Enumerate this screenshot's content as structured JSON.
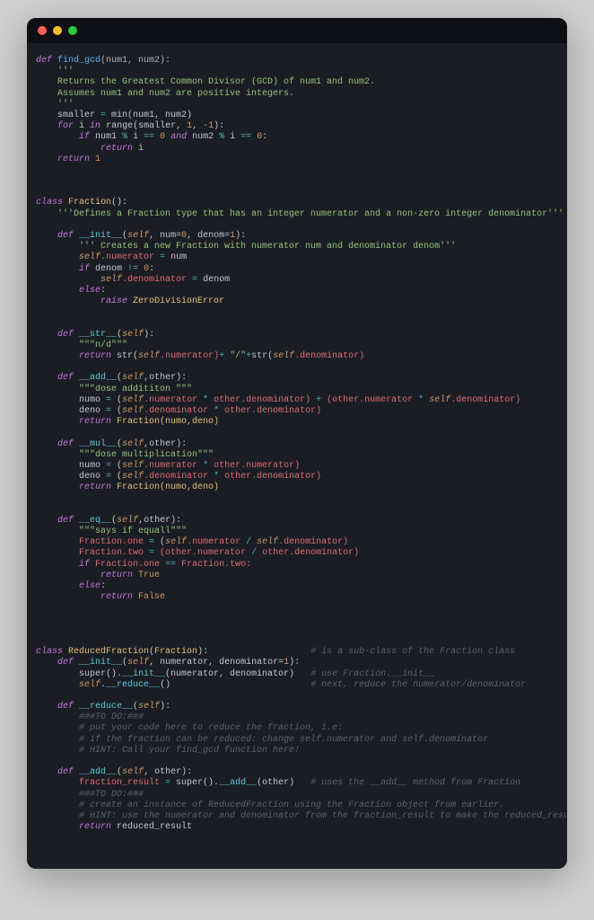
{
  "titlebar": {
    "dots": [
      "red",
      "yellow",
      "green"
    ]
  },
  "code": {
    "l1": "def ",
    "l1b": "find_gcd",
    "l1c": "(num1, num2):",
    "l2": "    '''",
    "l3": "    Returns the Greatest Common Divisor (GCD) of num1 and num2.",
    "l4": "    Assumes num1 and num2 are positive integers.",
    "l5": "    '''",
    "l6a": "    smaller ",
    "l6b": "=",
    "l6c": " min(num1, num2)",
    "l7a": "    ",
    "l7b": "for",
    "l7c": " i ",
    "l7d": "in",
    "l7e": " range(smaller, ",
    "l7f": "1",
    "l7g": ", ",
    "l7h": "-1",
    "l7i": "):",
    "l8a": "        ",
    "l8b": "if",
    "l8c": " num1 ",
    "l8d": "%",
    "l8e": " i ",
    "l8f": "==",
    "l8g": " ",
    "l8h": "0",
    "l8i": " ",
    "l8j": "and",
    "l8k": " num2 ",
    "l8l": "%",
    "l8m": " i ",
    "l8n": "==",
    "l8o": " ",
    "l8p": "0",
    "l8q": ":",
    "l9a": "            ",
    "l9b": "return",
    "l9c": " i",
    "l10a": "    ",
    "l10b": "return",
    "l10c": " ",
    "l10d": "1",
    "cls1a": "class ",
    "cls1b": "Fraction",
    "cls1c": "():",
    "cls2": "    '''Defines a Fraction type that has an integer numerator and a non-zero integer denominator'''",
    "init_a": "    ",
    "init_b": "def ",
    "init_c": "__init__",
    "init_d": "(",
    "init_e": "self",
    "init_f": ", num=",
    "init_g": "0",
    "init_h": ", denom=",
    "init_i": "1",
    "init_j": "):",
    "init2": "        ''' Creates a new Fraction with numerator num and denominator denom'''",
    "init3a": "        ",
    "init3b": "self",
    "init3c": ".numerator ",
    "init3d": "=",
    "init3e": " num",
    "init4a": "        ",
    "init4b": "if",
    "init4c": " denom ",
    "init4d": "!=",
    "init4e": " ",
    "init4f": "0",
    "init4g": ":",
    "init5a": "            ",
    "init5b": "self",
    "init5c": ".denominator ",
    "init5d": "=",
    "init5e": " denom",
    "init6a": "        ",
    "init6b": "else",
    "init6c": ":",
    "init7a": "            ",
    "init7b": "raise",
    "init7c": " ZeroDivisionError",
    "str1a": "    ",
    "str1b": "def ",
    "str1c": "__str__",
    "str1d": "(",
    "str1e": "self",
    "str1f": "):",
    "str2": "        \"\"\"n/d\"\"\"",
    "str3a": "        ",
    "str3b": "return",
    "str3c": " str(",
    "str3d": "self",
    "str3e": ".numerator)",
    "str3f": "+",
    "str3g": " ",
    "str3h": "\"/\"",
    "str3i": "+",
    "str3j": "str(",
    "str3k": "self",
    "str3l": ".denominator)",
    "add1a": "    ",
    "add1b": "def ",
    "add1c": "__add__",
    "add1d": "(",
    "add1e": "self",
    "add1f": ",other):",
    "add2": "        \"\"\"dose addititon \"\"\"",
    "add3a": "        numo ",
    "add3b": "=",
    "add3c": " (",
    "add3d": "self",
    "add3e": ".numerator ",
    "add3f": "*",
    "add3g": " other.denominator) ",
    "add3h": "+",
    "add3i": " (other.numerator ",
    "add3j": "*",
    "add3k": " ",
    "add3l": "self",
    "add3m": ".denominator)",
    "add4a": "        deno ",
    "add4b": "=",
    "add4c": " (",
    "add4d": "self",
    "add4e": ".denominator ",
    "add4f": "*",
    "add4g": " other.denominator)",
    "add5a": "        ",
    "add5b": "return",
    "add5c": " Fraction(numo,deno)",
    "mul1a": "    ",
    "mul1b": "def ",
    "mul1c": "__mul__",
    "mul1d": "(",
    "mul1e": "self",
    "mul1f": ",other):",
    "mul2": "        \"\"\"dose multiplication\"\"\"",
    "mul3a": "        numo ",
    "mul3b": "=",
    "mul3c": " (",
    "mul3d": "self",
    "mul3e": ".numerator ",
    "mul3f": "*",
    "mul3g": " other.numerator)",
    "mul4a": "        deno ",
    "mul4b": "=",
    "mul4c": " (",
    "mul4d": "self",
    "mul4e": ".denominator ",
    "mul4f": "*",
    "mul4g": " other.denominator)",
    "mul5a": "        ",
    "mul5b": "return",
    "mul5c": " Fraction(numo,deno)",
    "eq1a": "    ",
    "eq1b": "def ",
    "eq1c": "__eq__",
    "eq1d": "(",
    "eq1e": "self",
    "eq1f": ",other):",
    "eq2": "        \"\"\"says if equall\"\"\"",
    "eq3a": "        Fraction.one ",
    "eq3b": "=",
    "eq3c": " (",
    "eq3d": "self",
    "eq3e": ".numerator ",
    "eq3f": "/",
    "eq3g": " ",
    "eq3h": "self",
    "eq3i": ".denominator)",
    "eq4a": "        Fraction.two ",
    "eq4b": "=",
    "eq4c": " (other.numerator ",
    "eq4d": "/",
    "eq4e": " other.denominator)",
    "eq5a": "        ",
    "eq5b": "if",
    "eq5c": " Fraction.one ",
    "eq5d": "==",
    "eq5e": " Fraction.two:",
    "eq6a": "            ",
    "eq6b": "return",
    "eq6c": " True",
    "eq7a": "        ",
    "eq7b": "else",
    "eq7c": ":",
    "eq8a": "            ",
    "eq8b": "return",
    "eq8c": " False",
    "rf1a": "class ",
    "rf1b": "ReducedFraction",
    "rf1c": "(",
    "rf1d": "Fraction",
    "rf1e": "):",
    "rf1f": "                   ",
    "rf1g": "# is a sub-class of the Fraction class",
    "rf2a": "    ",
    "rf2b": "def ",
    "rf2c": "__init__",
    "rf2d": "(",
    "rf2e": "self",
    "rf2f": ", numerator, denominator=",
    "rf2g": "1",
    "rf2h": "):",
    "rf3a": "        super().",
    "rf3b": "__init__",
    "rf3c": "(numerator, denominator)   ",
    "rf3d": "# use Fraction.__init__",
    "rf4a": "        ",
    "rf4b": "self",
    "rf4c": ".",
    "rf4d": "__reduce__",
    "rf4e": "()                          ",
    "rf4f": "# next, reduce the numerator/denominator",
    "rf5a": "    ",
    "rf5b": "def ",
    "rf5c": "__reduce__",
    "rf5d": "(",
    "rf5e": "self",
    "rf5f": "):",
    "rf6": "        ###TO DO:###",
    "rf7": "        # put your code here to reduce the fraction, i.e:",
    "rf8": "        # if the fraction can be reduced: change self.numerator and self.denominator",
    "rf9": "        # HINT: Call your find_gcd function here!",
    "rf10a": "    ",
    "rf10b": "def ",
    "rf10c": "__add__",
    "rf10d": "(",
    "rf10e": "self",
    "rf10f": ", other):",
    "rf11a": "        fraction_result ",
    "rf11b": "=",
    "rf11c": " super().",
    "rf11d": "__add__",
    "rf11e": "(other)   ",
    "rf11f": "# uses the __add__ method from Fraction",
    "rf12": "        ###TO DO:###",
    "rf13": "        # create an instance of ReducedFraction using the Fraction object from earlier.",
    "rf14": "        # HINT: use the numerator and denominator from the fraction_result to make the reduced_result",
    "rf15a": "        ",
    "rf15b": "return",
    "rf15c": " reduced_result"
  }
}
